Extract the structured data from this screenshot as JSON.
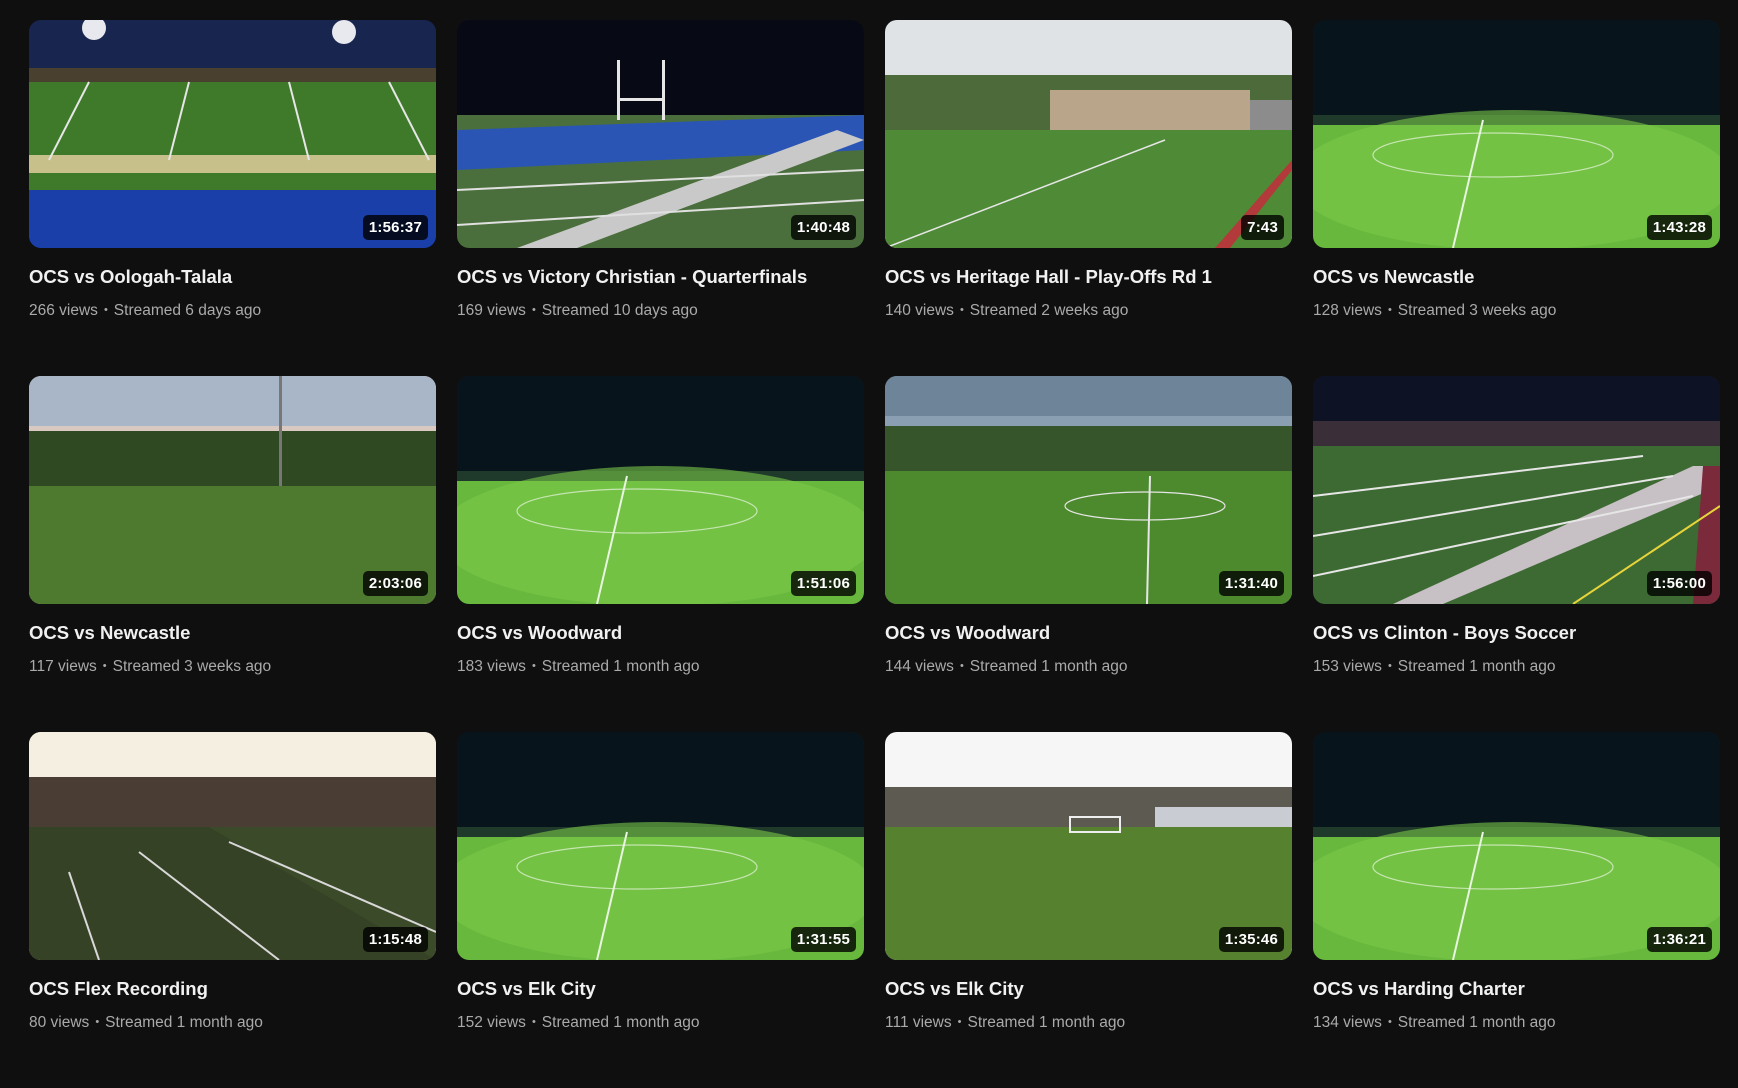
{
  "videos": [
    {
      "title": "OCS vs Oologah-Talala",
      "duration": "1:56:37",
      "views": "266 views",
      "streamed": "Streamed 6 days ago",
      "scene": "turf-night-blue"
    },
    {
      "title": "OCS vs Victory Christian - Quarterfinals",
      "duration": "1:40:48",
      "views": "169 views",
      "streamed": "Streamed 10 days ago",
      "scene": "turf-night-endzone"
    },
    {
      "title": "OCS vs Heritage Hall - Play-Offs Rd 1",
      "duration": "7:43",
      "views": "140 views",
      "streamed": "Streamed 2 weeks ago",
      "scene": "day-building"
    },
    {
      "title": "OCS vs Newcastle",
      "duration": "1:43:28",
      "views": "128 views",
      "streamed": "Streamed 3 weeks ago",
      "scene": "night-bright"
    },
    {
      "title": "OCS vs Newcastle",
      "duration": "2:03:06",
      "views": "117 views",
      "streamed": "Streamed 3 weeks ago",
      "scene": "dusk-trees"
    },
    {
      "title": "OCS vs Woodward",
      "duration": "1:51:06",
      "views": "183 views",
      "streamed": "Streamed 1 month ago",
      "scene": "night-bright"
    },
    {
      "title": "OCS vs Woodward",
      "duration": "1:31:40",
      "views": "144 views",
      "streamed": "Streamed 1 month ago",
      "scene": "overcast-trees"
    },
    {
      "title": "OCS vs Clinton - Boys Soccer",
      "duration": "1:56:00",
      "views": "153 views",
      "streamed": "Streamed 1 month ago",
      "scene": "turf-night-maroon"
    },
    {
      "title": "OCS Flex Recording",
      "duration": "1:15:48",
      "views": "80 views",
      "streamed": "Streamed 1 month ago",
      "scene": "sunset-turf"
    },
    {
      "title": "OCS vs Elk City",
      "duration": "1:31:55",
      "views": "152 views",
      "streamed": "Streamed 1 month ago",
      "scene": "night-bright"
    },
    {
      "title": "OCS vs Elk City",
      "duration": "1:35:46",
      "views": "111 views",
      "streamed": "Streamed 1 month ago",
      "scene": "day-white-sky"
    },
    {
      "title": "OCS vs Harding Charter",
      "duration": "1:36:21",
      "views": "134 views",
      "streamed": "Streamed 1 month ago",
      "scene": "night-bright"
    }
  ],
  "colors": {
    "background": "#0f0f0f",
    "title": "#f1f1f1",
    "meta": "#aaaaaa",
    "duration_bg": "rgba(0,0,0,0.8)"
  }
}
